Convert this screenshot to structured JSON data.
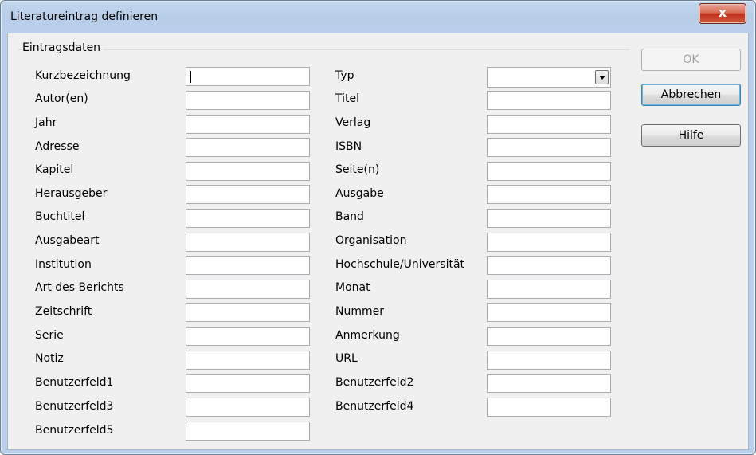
{
  "window": {
    "title": "Literatureintrag definieren",
    "close_label": "x"
  },
  "group": {
    "label": "Eintragsdaten"
  },
  "buttons": {
    "ok": "OK",
    "cancel": "Abbrechen",
    "help": "Hilfe"
  },
  "left_fields": [
    {
      "label": "Kurzbezeichnung"
    },
    {
      "label": "Autor(en)"
    },
    {
      "label": "Jahr"
    },
    {
      "label": "Adresse"
    },
    {
      "label": "Kapitel"
    },
    {
      "label": "Herausgeber"
    },
    {
      "label": "Buchtitel"
    },
    {
      "label": "Ausgabeart"
    },
    {
      "label": "Institution"
    },
    {
      "label": "Art des Berichts"
    },
    {
      "label": "Zeitschrift"
    },
    {
      "label": "Serie"
    },
    {
      "label": "Notiz"
    },
    {
      "label": "Benutzerfeld1"
    },
    {
      "label": "Benutzerfeld3"
    },
    {
      "label": "Benutzerfeld5"
    }
  ],
  "right_fields": [
    {
      "label": "Typ"
    },
    {
      "label": "Titel"
    },
    {
      "label": "Verlag"
    },
    {
      "label": "ISBN"
    },
    {
      "label": "Seite(n)"
    },
    {
      "label": "Ausgabe"
    },
    {
      "label": "Band"
    },
    {
      "label": "Organisation"
    },
    {
      "label": "Hochschule/Universität"
    },
    {
      "label": "Monat"
    },
    {
      "label": "Nummer"
    },
    {
      "label": "Anmerkung"
    },
    {
      "label": "URL"
    },
    {
      "label": "Benutzerfeld2"
    },
    {
      "label": "Benutzerfeld4"
    }
  ],
  "icons": {
    "close": "close-icon",
    "combo": "chevron-down-icon"
  }
}
